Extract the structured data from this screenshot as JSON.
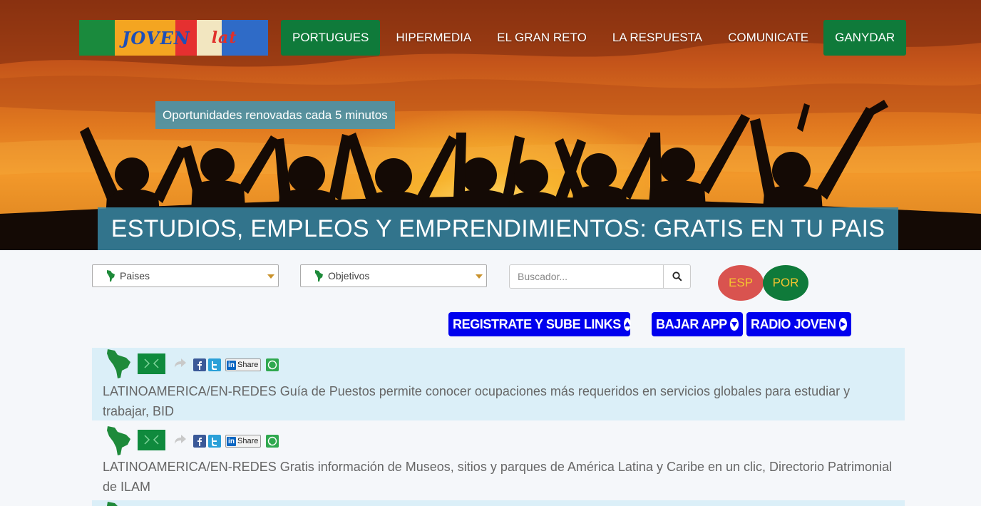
{
  "nav": {
    "logo_text": "JOVEN",
    "logo_text_2": "lat",
    "items": [
      {
        "label": "PORTUGUES",
        "boxed": true
      },
      {
        "label": "HIPERMEDIA",
        "boxed": false
      },
      {
        "label": "EL GRAN RETO",
        "boxed": false
      },
      {
        "label": "LA RESPUESTA",
        "boxed": false
      },
      {
        "label": "COMUNICATE",
        "boxed": false
      },
      {
        "label": "GANYDAR",
        "boxed": true
      }
    ]
  },
  "hero": {
    "tagline": "Oportunidades renovadas cada 5 minutos",
    "title": "ESTUDIOS, EMPLEOS Y EMPRENDIMIENTOS: GRATIS EN TU PAIS"
  },
  "filters": {
    "countries_label": "Paises",
    "objectives_label": "Objetivos",
    "search_placeholder": "Buscador..."
  },
  "languages": {
    "esp": "ESP",
    "por": "POR"
  },
  "actions": {
    "register": "REGISTRATE Y SUBE LINKS",
    "download_app": "BAJAR APP",
    "radio": "RADIO JOVEN"
  },
  "news": [
    {
      "text": "LATINOAMERICA/EN-REDES Guía de Puestos permite conocer ocupaciones más requeridos en servicios globales para estudiar y trabajar, BID",
      "share_label": "Share"
    },
    {
      "text": "LATINOAMERICA/EN-REDES Gratis información de Museos, sitios y parques de América Latina y Caribe en un clic, Directorio Patrimonial de ILAM",
      "share_label": "Share"
    }
  ],
  "colors": {
    "green": "#0f7a3a",
    "action_blue": "#0000ee",
    "hero_overlay": "#3787a5",
    "esp_red": "#d9534f",
    "lang_text": "#f4c430"
  }
}
